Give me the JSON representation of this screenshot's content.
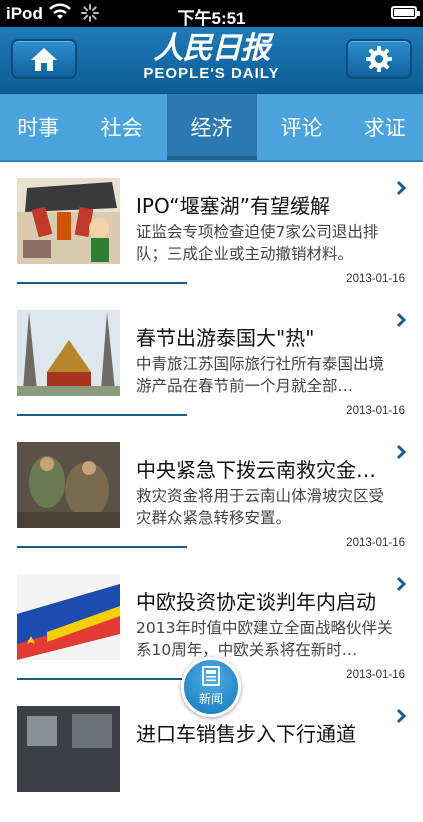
{
  "status_bar": {
    "carrier": "iPod",
    "time": "下午5:51"
  },
  "header": {
    "logo_cn": "人民日报",
    "logo_en": "PEOPLE'S DAILY"
  },
  "tabs": [
    {
      "label": "时事"
    },
    {
      "label": "社会"
    },
    {
      "label": "经济",
      "active": true
    },
    {
      "label": "评论"
    },
    {
      "label": "求证"
    }
  ],
  "articles": [
    {
      "title": "IPO“堰塞湖”有望缓解",
      "summary": "证监会专项检查迫使7家公司退出排队；三成企业或主动撤销材料。",
      "date": "2013-01-16"
    },
    {
      "title": "春节出游泰国大\"热\"",
      "summary": "中青旅江苏国际旅行社所有泰国出境游产品在春节前一个月就全部…",
      "date": "2013-01-16"
    },
    {
      "title": "中央紧急下拨云南救灾金…",
      "summary": "救灾资金将用于云南山体滑坡灾区受灾群众紧急转移安置。",
      "date": "2013-01-16"
    },
    {
      "title": "中欧投资协定谈判年内启动",
      "summary": "2013年时值中欧建立全面战略伙伴关系10周年，中欧关系将在新时…",
      "date": "2013-01-16"
    },
    {
      "title": "进口车销售步入下行通道",
      "summary": "",
      "date": ""
    }
  ],
  "fab": {
    "label": "新闻"
  },
  "colors": {
    "header": "#1a6fae",
    "tabs": "#4aa3dc",
    "active_tab": "#2b78b2",
    "chevron": "#1a5c8a"
  }
}
